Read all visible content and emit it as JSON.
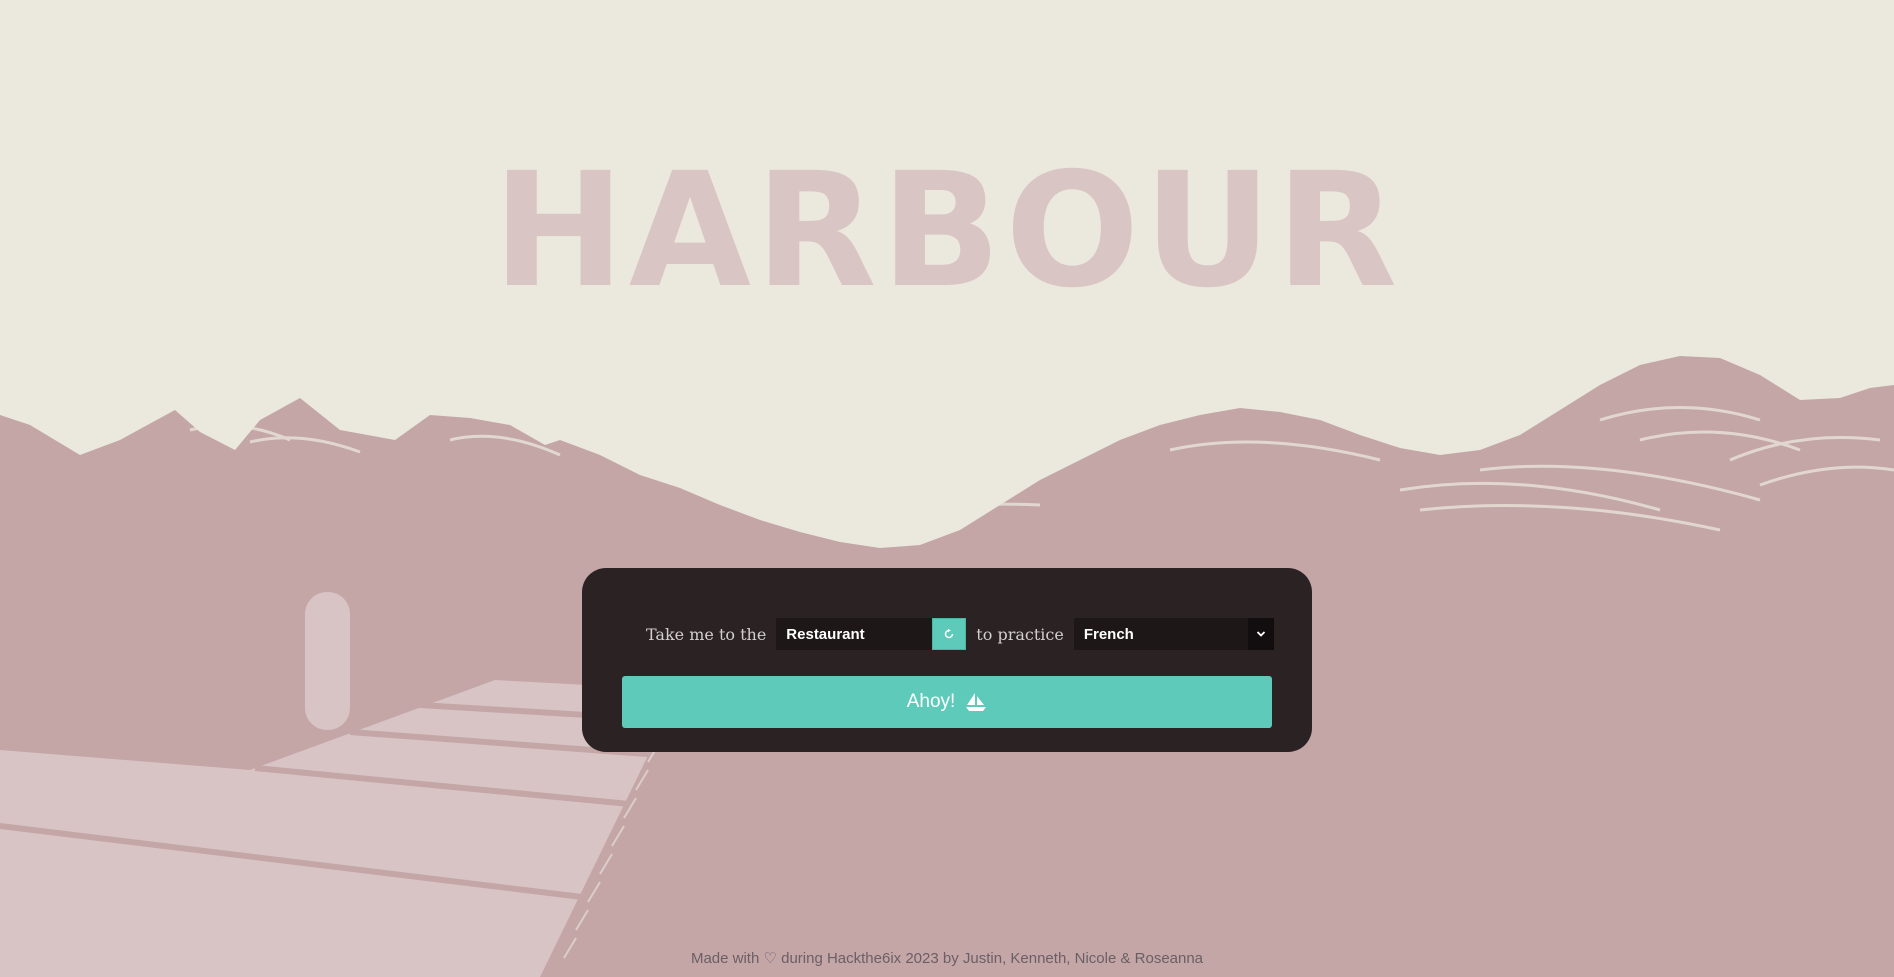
{
  "app": {
    "title": "HARBOUR"
  },
  "form": {
    "prefix_label": "Take me to the",
    "location_value": "Restaurant",
    "refresh_icon": "refresh-icon",
    "middle_label": "to practice",
    "language_value": "French",
    "language_dropdown_icon": "chevron-down-icon",
    "submit_label": "Ahoy!",
    "submit_icon": "sailboat-icon"
  },
  "footer": {
    "text": "Made with ♡ during Hackthe6ix 2023 by Justin, Kenneth, Nicole & Roseanna"
  },
  "colors": {
    "background": "#ebe8dd",
    "title": "#dac5c5",
    "sea": "#c4a6a7",
    "pier": "#d8c4c4",
    "panel": "#2a2223",
    "accent": "#5ecab9"
  }
}
